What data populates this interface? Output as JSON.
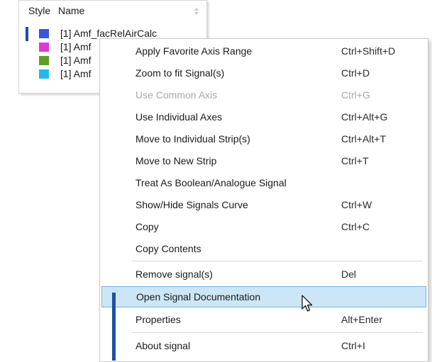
{
  "signal_panel": {
    "header_style": "Style",
    "header_name": "Name",
    "signals": [
      {
        "name": "[1] Amf_facRelAirCalc",
        "color": "#3b55d9"
      },
      {
        "name": "[1] Amf",
        "color": "#d93bd3"
      },
      {
        "name": "[1] Amf",
        "color": "#5fa022"
      },
      {
        "name": "[1] Amf",
        "color": "#21b8ec"
      }
    ]
  },
  "context_menu": {
    "items": [
      {
        "label": "Apply Favorite Axis Range",
        "shortcut": "Ctrl+Shift+D",
        "disabled": false
      },
      {
        "label": "Zoom to fit Signal(s)",
        "shortcut": "Ctrl+D",
        "disabled": false
      },
      {
        "label": "Use Common Axis",
        "shortcut": "Ctrl+G",
        "disabled": true
      },
      {
        "label": "Use Individual Axes",
        "shortcut": "Ctrl+Alt+G",
        "disabled": false
      },
      {
        "label": "Move to Individual Strip(s)",
        "shortcut": "Ctrl+Alt+T",
        "disabled": false
      },
      {
        "label": "Move to New Strip",
        "shortcut": "Ctrl+T",
        "disabled": false
      },
      {
        "label": "Treat As Boolean/Analogue Signal",
        "shortcut": "",
        "disabled": false
      },
      {
        "label": "Show/Hide Signals Curve",
        "shortcut": "Ctrl+W",
        "disabled": false
      },
      {
        "label": "Copy",
        "shortcut": "Ctrl+C",
        "disabled": false
      },
      {
        "label": "Copy Contents",
        "shortcut": "",
        "disabled": false
      },
      {
        "label": "Remove signal(s)",
        "shortcut": "Del",
        "disabled": false
      },
      {
        "label": "Open Signal Documentation",
        "shortcut": "",
        "disabled": false,
        "highlighted": true
      },
      {
        "label": "Properties",
        "shortcut": "Alt+Enter",
        "disabled": false
      },
      {
        "label": "About signal",
        "shortcut": "Ctrl+I",
        "disabled": false
      }
    ]
  },
  "colors": {
    "selection_accent": "#1f4fa0",
    "highlight_bg": "#cde6f7",
    "highlight_border": "#6fb5e4"
  },
  "icons": {
    "sort": "sort-arrows-icon",
    "cursor": "mouse-pointer-icon"
  }
}
